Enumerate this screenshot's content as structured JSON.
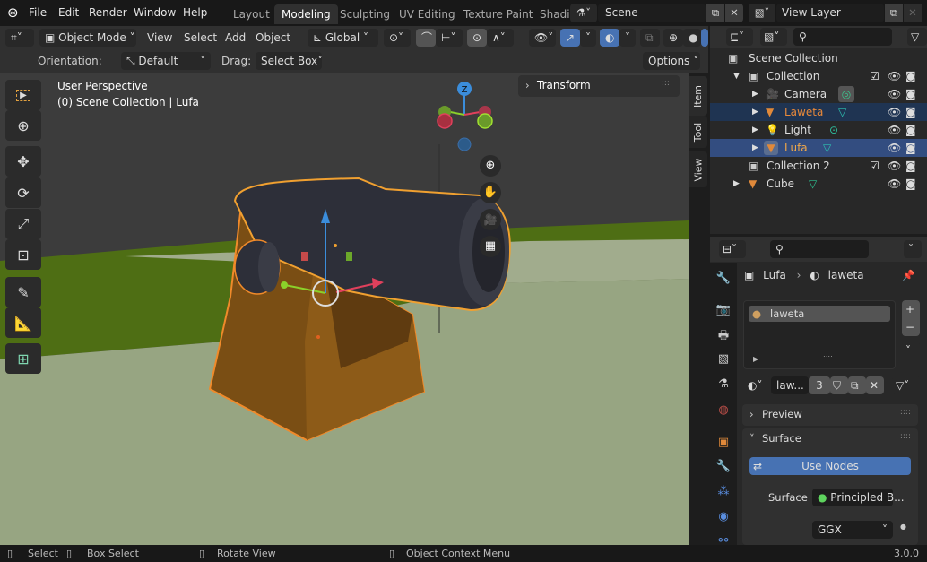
{
  "app": {
    "version": "3.0.0"
  },
  "topbar": {
    "menus": [
      "File",
      "Edit",
      "Render",
      "Window",
      "Help"
    ],
    "workspaces": [
      "Layout",
      "Modeling",
      "Sculpting",
      "UV Editing",
      "Texture Paint",
      "Shadi"
    ],
    "active_workspace": "Modeling",
    "scene": "Scene",
    "view_layer": "View Layer"
  },
  "viewport_header": {
    "mode": "Object Mode",
    "menus": [
      "View",
      "Select",
      "Add",
      "Object"
    ],
    "orientation_global": "Global"
  },
  "tool_settings": {
    "orientation_label": "Orientation:",
    "orientation_value": "Default",
    "drag_label": "Drag:",
    "drag_value": "Select Box",
    "options": "Options"
  },
  "viewport": {
    "perspective": "User Perspective",
    "collection_info": "(0) Scene Collection | Lufa",
    "transform_panel": "Transform",
    "gizmo_axes": [
      "Z",
      "Y",
      "X"
    ],
    "sidebar_tabs": [
      "Item",
      "Tool",
      "View"
    ]
  },
  "toolbar": {
    "tools": [
      "select-box",
      "cursor",
      "move",
      "rotate",
      "scale",
      "transform",
      "annotate",
      "measure",
      "add-cube"
    ],
    "active_tool": "move"
  },
  "outliner": {
    "root": "Scene Collection",
    "items": [
      {
        "name": "Collection",
        "type": "collection",
        "indent": 1,
        "checked": true
      },
      {
        "name": "Camera",
        "type": "camera",
        "indent": 2
      },
      {
        "name": "Laweta",
        "type": "mesh",
        "indent": 2,
        "selected": true
      },
      {
        "name": "Light",
        "type": "light",
        "indent": 2
      },
      {
        "name": "Lufa",
        "type": "mesh",
        "indent": 2,
        "active": true
      },
      {
        "name": "Collection 2",
        "type": "collection",
        "indent": 1,
        "checked": true
      },
      {
        "name": "Cube",
        "type": "mesh",
        "indent": 1
      }
    ]
  },
  "properties": {
    "breadcrumb_object": "Lufa",
    "breadcrumb_material": "laweta",
    "material_slots": [
      "laweta"
    ],
    "material_name_short": "law...",
    "user_count": "3",
    "preview_label": "Preview",
    "surface_label": "Surface",
    "use_nodes": "Use Nodes",
    "surface_field_label": "Surface",
    "surface_value": "Principled B...",
    "distribution": "GGX"
  },
  "status": {
    "select": "Select",
    "box_select": "Box Select",
    "rotate": "Rotate View",
    "context": "Object Context Menu",
    "version": "3.0.0"
  },
  "colors": {
    "accent": "#4772b3",
    "selection": "#334d80",
    "orange": "#e07b24"
  }
}
